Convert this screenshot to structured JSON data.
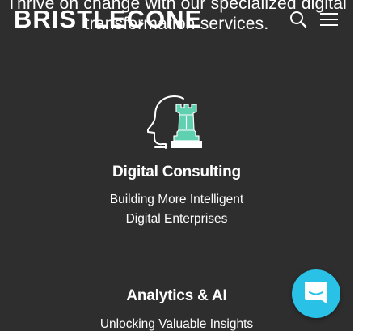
{
  "hero": {
    "tagline_line1": "Thrive on change with our specialized digital",
    "tagline_line2": "transformation services."
  },
  "header": {
    "logo_text": "BRISTLECONE",
    "search_icon": "search-icon",
    "menu_icon": "hamburger-menu-icon"
  },
  "services": [
    {
      "icon": "head-with-chess-rook-icon",
      "title": "Digital Consulting",
      "desc_line1": "Building More Intelligent",
      "desc_line2": "Digital Enterprises"
    },
    {
      "title": "Analytics & AI",
      "desc_line1": "Unlocking Valuable Insights"
    }
  ],
  "chat": {
    "icon": "chat-bubble-icon"
  },
  "colors": {
    "background": "#2e2e2f",
    "accent_teal": "#5fd0b0",
    "chat_button": "#2ac1e6",
    "text": "#ffffff"
  }
}
